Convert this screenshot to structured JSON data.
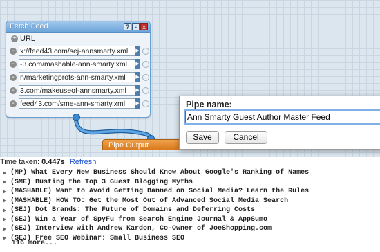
{
  "module": {
    "title": "Fetch Feed",
    "help_icon": "?",
    "minimize_icon": "-",
    "close_icon": "x",
    "add_icon": "+",
    "remove_icon": "-",
    "url_label": "URL",
    "feeds": [
      "x://feed43.com/sej-annsmarty.xml",
      "-3.com/mashable-ann-smarty.xml",
      "n/marketingprofs-ann-smarty.xml",
      "3.com/makeuseof-annsmarty.xml",
      "feed43.com/sme-ann-smarty.xml"
    ]
  },
  "pipe_output": {
    "label": "Pipe Output"
  },
  "dialog": {
    "label": "Pipe name:",
    "value": "Ann Smarty Guest Author Master Feed",
    "save_label": "Save",
    "cancel_label": "Cancel"
  },
  "output": {
    "time_label": "Time taken:",
    "time_value": "0.447s",
    "refresh_label": "Refresh",
    "items": [
      "(MP) What Every New Business Should Know About Google's Ranking of Names",
      "(SME) Busting the Top 3 Guest Blogging Myths",
      "(MASHABLE) Want to Avoid Getting Banned on Social Media? Learn the Rules",
      "(MASHABLE) HOW TO: Get the Most Out of Advanced Social Media Search",
      "(SEJ) Dot Brands: The Future of Domains and Deferring Costs",
      "(SEJ) Win a Year of SpyFu from Search Engine Journal & AppSumo",
      "(SEJ) Interview with Andrew Kardon, Co-Owner of JoeShopping.com",
      "(SEJ) Free SEO Webinar: Small Business SEO"
    ],
    "more_label": "+16 more..."
  },
  "colors": {
    "canvas": "#dce6ef",
    "module_border": "#6a9fd0",
    "pipe_output": "#e08a2c",
    "wire": "#3e89cf",
    "link": "#1a4fd1"
  }
}
